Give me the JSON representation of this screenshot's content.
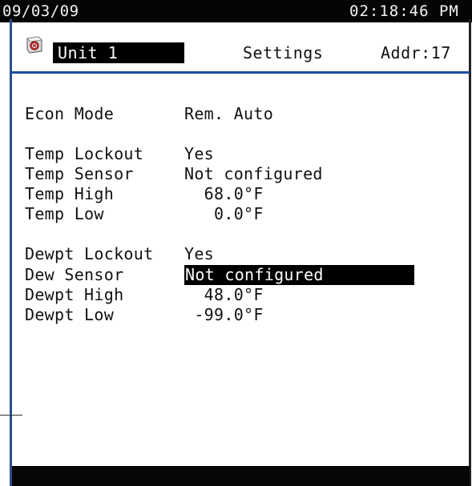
{
  "status_bar": {
    "date": "09/03/09",
    "time": "02:18:46 PM"
  },
  "header": {
    "unit_icon": "lockout-icon",
    "unit_name": "Unit 1",
    "title": "Settings",
    "address": "Addr:17"
  },
  "settings": {
    "econ_mode": {
      "label": "Econ Mode",
      "value": "Rem. Auto"
    },
    "temp_lockout": {
      "label": "Temp Lockout",
      "value": "Yes"
    },
    "temp_sensor": {
      "label": "Temp Sensor",
      "value": "Not configured"
    },
    "temp_high": {
      "label": "Temp High",
      "value": "  68.0°F"
    },
    "temp_low": {
      "label": "Temp Low",
      "value": "   0.0°F"
    },
    "dewpt_lockout": {
      "label": "Dewpt Lockout",
      "value": "Yes"
    },
    "dew_sensor": {
      "label": "Dew Sensor",
      "value": "Not configured"
    },
    "dewpt_high": {
      "label": "Dewpt High",
      "value": "  48.0°F"
    },
    "dewpt_low": {
      "label": "Dewpt Low",
      "value": " -99.0°F"
    }
  },
  "colors": {
    "accent": "#1e4fa0",
    "bar": "#050505",
    "selection": "#000000"
  }
}
